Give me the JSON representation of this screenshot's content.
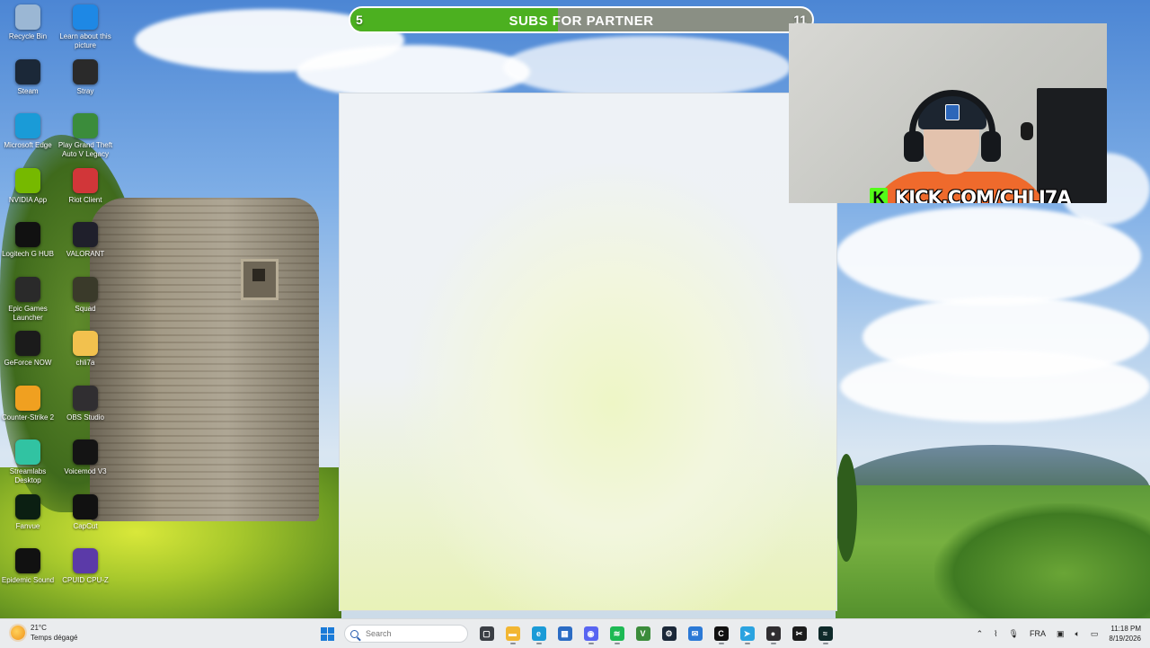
{
  "desktop_icons": [
    {
      "label": "Recycle Bin",
      "icon": "recycle-bin-icon",
      "color": "#9bb7d4"
    },
    {
      "label": "Learn about this picture",
      "icon": "learn-picture-icon",
      "color": "#1e88e5"
    },
    {
      "label": "Steam",
      "icon": "steam-icon",
      "color": "#1b2838"
    },
    {
      "label": "Stray",
      "icon": "stray-icon",
      "color": "#2a2a2a"
    },
    {
      "label": "Microsoft Edge",
      "icon": "edge-icon",
      "color": "#1a9bd7"
    },
    {
      "label": "Play Grand Theft Auto V Legacy",
      "icon": "gta-icon",
      "color": "#3b8c3b"
    },
    {
      "label": "NVIDIA App",
      "icon": "nvidia-icon",
      "color": "#76b900"
    },
    {
      "label": "Riot Client",
      "icon": "riot-icon",
      "color": "#d13639"
    },
    {
      "label": "Logitech G HUB",
      "icon": "logitech-icon",
      "color": "#111111"
    },
    {
      "label": "VALORANT",
      "icon": "valorant-icon",
      "color": "#1f1f2b"
    },
    {
      "label": "Epic Games Launcher",
      "icon": "epic-icon",
      "color": "#2a2a2a"
    },
    {
      "label": "Squad",
      "icon": "squad-icon",
      "color": "#3a3a2a"
    },
    {
      "label": "GeForce NOW",
      "icon": "geforce-now-icon",
      "color": "#1b1b1b"
    },
    {
      "label": "chli7a",
      "icon": "folder-icon",
      "color": "#f2c14e"
    },
    {
      "label": "Counter-Strike 2",
      "icon": "cs-icon",
      "color": "#f0a020"
    },
    {
      "label": "OBS Studio",
      "icon": "obs-icon",
      "color": "#302e31"
    },
    {
      "label": "Streamlabs Desktop",
      "icon": "streamlabs-icon",
      "color": "#31c3a2"
    },
    {
      "label": "Voicemod V3",
      "icon": "voicemod-icon",
      "color": "#141414"
    },
    {
      "label": "Fanvue",
      "icon": "fanvue-icon",
      "color": "#0b1f12"
    },
    {
      "label": "CapCut",
      "icon": "capcut-icon",
      "color": "#111111"
    },
    {
      "label": "Epidemic Sound",
      "icon": "epidemic-sound-icon",
      "color": "#111111"
    },
    {
      "label": "CPUID CPU-Z",
      "icon": "cpuz-icon",
      "color": "#5b3aa8"
    }
  ],
  "goal_bar": {
    "current": "5",
    "target": "11",
    "title": "SUBS FOR PARTNER",
    "progress": 0.45,
    "fill_color": "#4cb020"
  },
  "webcam": {
    "banner_url": "KICK.COM/CHLI7A",
    "banner_logo": "K",
    "accent_color": "#53fc18"
  },
  "taskbar": {
    "weather_temp": "21°C",
    "weather_desc": "Temps dégagé",
    "search_placeholder": "Search",
    "pinned": [
      {
        "icon": "task-view-icon",
        "color": "#3b3f45",
        "glyph": "▢"
      },
      {
        "icon": "file-explorer-icon",
        "color": "#f2b632",
        "glyph": "▬"
      },
      {
        "icon": "edge-icon",
        "color": "#1a9bd7",
        "glyph": "e"
      },
      {
        "icon": "ms-store-icon",
        "color": "#2b6cc4",
        "glyph": "▦"
      },
      {
        "icon": "discord-icon",
        "color": "#5865f2",
        "glyph": "◉"
      },
      {
        "icon": "spotify-icon",
        "color": "#1db954",
        "glyph": "≋"
      },
      {
        "icon": "gta-icon",
        "color": "#3b8c3b",
        "glyph": "V"
      },
      {
        "icon": "steam-icon",
        "color": "#1b2838",
        "glyph": "⚙"
      },
      {
        "icon": "mail-app-icon",
        "color": "#2b79d6",
        "glyph": "✉"
      },
      {
        "icon": "capcut-icon",
        "color": "#111111",
        "glyph": "C"
      },
      {
        "icon": "telegram-icon",
        "color": "#2aa3e0",
        "glyph": "➤"
      },
      {
        "icon": "obs-icon",
        "color": "#302e31",
        "glyph": "●"
      },
      {
        "icon": "capcut-alt-icon",
        "color": "#1c1c1c",
        "glyph": "✂"
      },
      {
        "icon": "voicemod-icon",
        "color": "#0f2a2a",
        "glyph": "≈"
      }
    ],
    "language": "FRA",
    "time": "11:18 PM",
    "date": "8/19/2026"
  }
}
